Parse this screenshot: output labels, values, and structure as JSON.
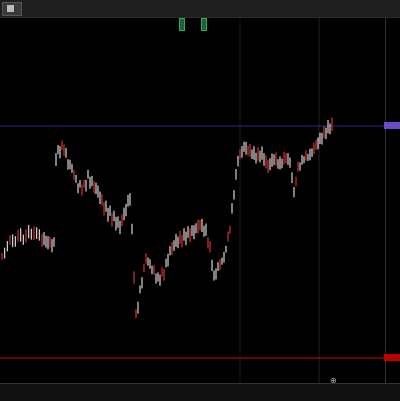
{
  "window": {
    "tab_label": "",
    "symbol_line": "",
    "info_line": ""
  },
  "trade_buttons": {
    "sell_label": "",
    "buy_label": ""
  },
  "right_panel": {
    "lines": [
      {
        "text": "",
        "color": "#ff4a4a"
      },
      {
        "text": "",
        "color": "#ff4a4a"
      },
      {
        "text": "",
        "color": "#00d000"
      },
      {
        "text": "",
        "color": "#00d000"
      },
      {
        "text": "",
        "color": "#00d000"
      }
    ]
  },
  "price_axis": {
    "tag_label": "",
    "red_tag_label": "",
    "ticks": [
      "",
      "",
      "",
      "",
      "",
      "",
      "",
      "",
      "",
      "",
      "",
      "",
      "",
      "",
      "",
      "",
      "",
      "",
      "",
      "",
      "",
      "",
      ""
    ]
  },
  "time_axis": {
    "ticks": [
      "",
      "",
      "",
      "",
      "",
      "",
      "",
      "",
      "",
      "",
      "",
      "",
      "",
      "",
      "",
      "",
      "",
      "",
      "",
      "",
      "",
      "",
      ""
    ]
  },
  "chart_data": {
    "type": "bar",
    "title": "",
    "colors": {
      "up": "#ffffff",
      "down": "#ff3a3a",
      "current_price_line": "#3b3bb5",
      "red_level": "#dd0000"
    }
  },
  "icons": {
    "cursor": "crosshair-icon"
  }
}
